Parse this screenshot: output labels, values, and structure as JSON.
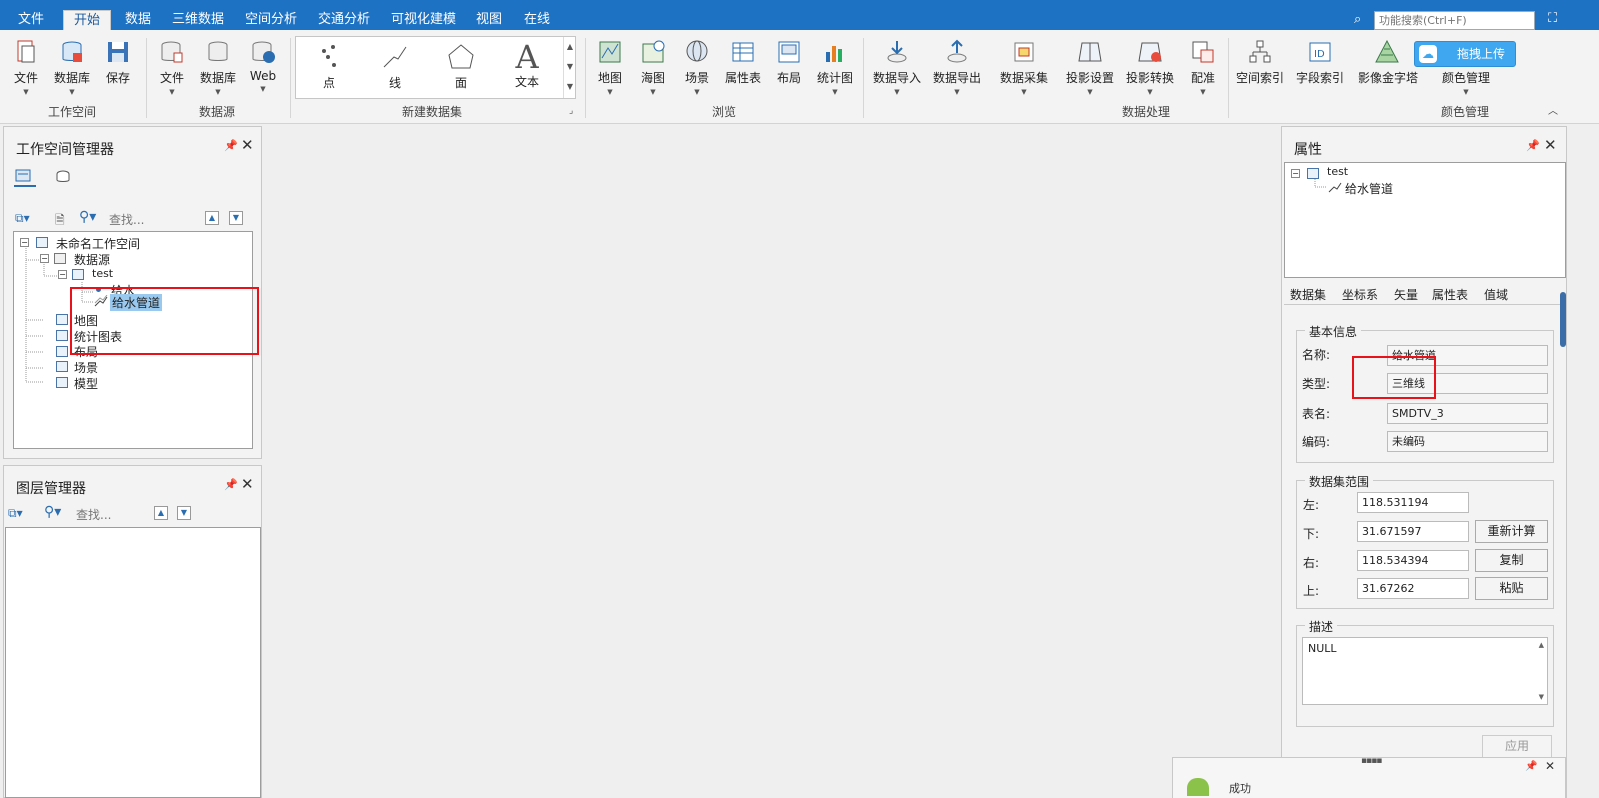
{
  "menu": {
    "tabs": [
      "文件",
      "开始",
      "数据",
      "三维数据",
      "空间分析",
      "交通分析",
      "可视化建模",
      "视图",
      "在线"
    ],
    "active": "开始",
    "search_placeholder": "功能搜索(Ctrl+F)"
  },
  "ribbon": {
    "workspace": {
      "label": "工作空间",
      "buttons": [
        "文件",
        "数据库",
        "保存"
      ]
    },
    "datasource": {
      "label": "数据源",
      "buttons": [
        "文件",
        "数据库",
        "Web"
      ]
    },
    "new_dataset": {
      "label": "新建数据集",
      "buttons": [
        "点",
        "线",
        "面",
        "文本"
      ]
    },
    "browse": {
      "label": "浏览",
      "buttons": [
        "地图",
        "海图",
        "场景",
        "属性表",
        "布局",
        "统计图"
      ]
    },
    "data_processing": {
      "label": "数据处理",
      "buttons": [
        "数据导入",
        "数据导出",
        "数据采集",
        "投影设置",
        "投影转换",
        "配准",
        "空间索引",
        "字段索引",
        "影像金字塔"
      ]
    },
    "color": {
      "label": "颜色管理",
      "buttons": [
        "颜色管理"
      ]
    },
    "upload_button": "拖拽上传"
  },
  "workspace_panel": {
    "title": "工作空间管理器",
    "search_placeholder": "查找...",
    "tree": {
      "root": "未命名工作空间",
      "datasources": "数据源",
      "datasource": "test",
      "dataset1": "给水",
      "dataset2": "给水管道",
      "map": "地图",
      "chart": "统计图表",
      "layout": "布局",
      "scene": "场景",
      "model": "模型"
    }
  },
  "layer_panel": {
    "title": "图层管理器",
    "search_placeholder": "查找..."
  },
  "properties_panel": {
    "title": "属性",
    "tree": {
      "root": "test",
      "child": "给水管道"
    },
    "tabs": [
      "数据集",
      "坐标系",
      "矢量",
      "属性表",
      "值域"
    ],
    "basic_info": {
      "title": "基本信息",
      "name_label": "名称:",
      "name_value": "给水管道",
      "type_label": "类型:",
      "type_value": "三维线",
      "table_label": "表名:",
      "table_value": "SMDTV_3",
      "encoding_label": "编码:",
      "encoding_value": "未编码"
    },
    "bounds": {
      "title": "数据集范围",
      "left_label": "左:",
      "left_value": "118.531194",
      "bottom_label": "下:",
      "bottom_value": "31.671597",
      "right_label": "右:",
      "right_value": "118.534394",
      "top_label": "上:",
      "top_value": "31.67262",
      "recalc_button": "重新计算",
      "copy_button": "复制",
      "paste_button": "粘贴"
    },
    "description": {
      "title": "描述",
      "value": "NULL"
    },
    "apply_button": "应用"
  },
  "toast": {
    "text": "成功"
  },
  "colors": {
    "accent": "#1e72c4",
    "highlight": "#e8121a",
    "selection": "#99c9ef"
  }
}
